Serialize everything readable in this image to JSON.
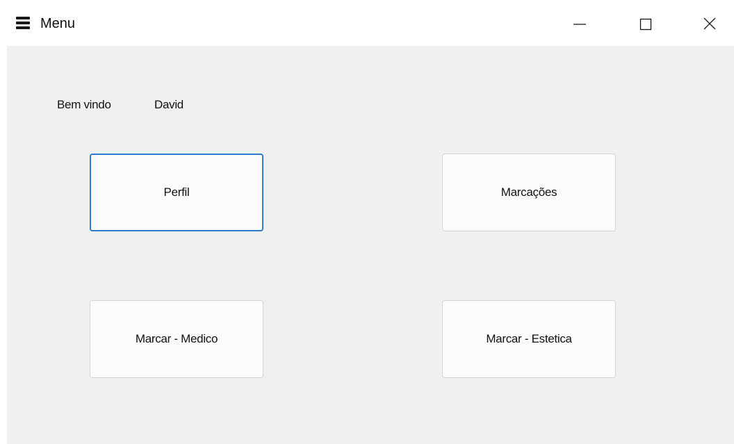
{
  "window": {
    "title": "Menu",
    "icons": {
      "app": "hamburger-menu-icon",
      "minimize": "minimize-icon",
      "maximize": "maximize-icon",
      "close": "close-icon"
    }
  },
  "main": {
    "welcome_label": "Bem vindo",
    "user_name": "David",
    "buttons": [
      {
        "label": "Perfil",
        "focused": true
      },
      {
        "label": "Marcações",
        "focused": false
      },
      {
        "label": "Marcar - Medico",
        "focused": false
      },
      {
        "label": "Marcar - Estetica",
        "focused": false
      }
    ]
  },
  "colors": {
    "client_background": "#f0f0f0",
    "focus_border": "#2a7bd4",
    "button_background": "#fcfcfc"
  }
}
